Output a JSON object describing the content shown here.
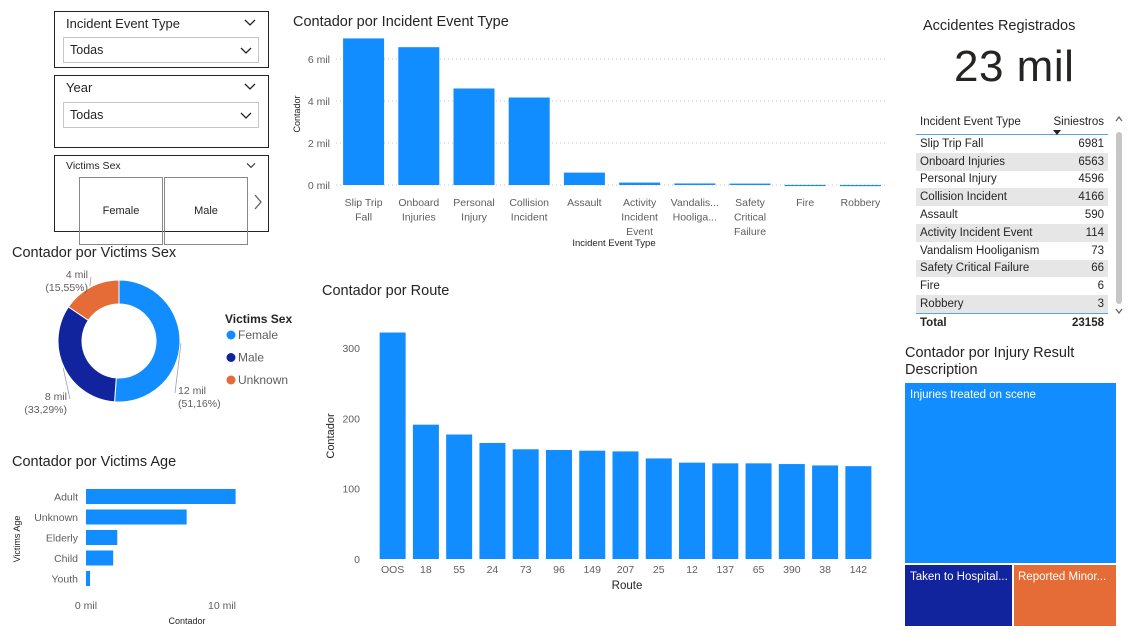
{
  "slicers": {
    "incident_type": {
      "title": "Incident Event Type",
      "value": "Todas"
    },
    "year": {
      "title": "Year",
      "value": "Todas"
    },
    "victims_sex": {
      "title": "Victims Sex",
      "tiles": [
        "Female",
        "Male"
      ]
    }
  },
  "kpi": {
    "title": "Accidentes Registrados",
    "value": "23 mil"
  },
  "matrix": {
    "headers": [
      "Incident Event Type",
      "Siniestros"
    ],
    "rows": [
      {
        "label": "Slip Trip Fall",
        "value": "6981"
      },
      {
        "label": "Onboard Injuries",
        "value": "6563"
      },
      {
        "label": "Personal Injury",
        "value": "4596"
      },
      {
        "label": "Collision Incident",
        "value": "4166"
      },
      {
        "label": "Assault",
        "value": "590"
      },
      {
        "label": "Activity Incident Event",
        "value": "114"
      },
      {
        "label": "Vandalism Hooliganism",
        "value": "73"
      },
      {
        "label": "Safety Critical Failure",
        "value": "66"
      },
      {
        "label": "Fire",
        "value": "6"
      },
      {
        "label": "Robbery",
        "value": "3"
      }
    ],
    "total_label": "Total",
    "total_value": "23158"
  },
  "colors": {
    "primary": "#118DFF",
    "navy": "#12239E",
    "orange": "#E66C37"
  },
  "chart_data": [
    {
      "type": "bar",
      "title": "Contador por Incident Event Type",
      "xlabel": "Incident Event Type",
      "ylabel": "Contador",
      "categories": [
        [
          "Slip Trip",
          "Fall"
        ],
        [
          "Onboard",
          "Injuries"
        ],
        [
          "Personal",
          "Injury"
        ],
        [
          "Collision",
          "Incident"
        ],
        [
          "Assault"
        ],
        [
          "Activity",
          "Incident",
          "Event"
        ],
        [
          "Vandalis...",
          "Hooliga..."
        ],
        [
          "Safety",
          "Critical",
          "Failure"
        ],
        [
          "Fire"
        ],
        [
          "Robbery"
        ]
      ],
      "values": [
        6981,
        6563,
        4596,
        4166,
        590,
        114,
        73,
        66,
        6,
        3
      ],
      "ylim": [
        0,
        7000
      ],
      "yticks": [
        0,
        2000,
        4000,
        6000
      ],
      "ytick_labels": [
        "0 mil",
        "2 mil",
        "4 mil",
        "6 mil"
      ],
      "grid": true
    },
    {
      "type": "pie",
      "title": "Contador por Victims Sex",
      "legend_title": "Victims Sex",
      "categories": [
        "Female",
        "Male",
        "Unknown"
      ],
      "values": [
        11848,
        7710,
        3600
      ],
      "labels": [
        [
          "12 mil",
          "(51,16%)"
        ],
        [
          "8 mil",
          "(33,29%)"
        ],
        [
          "4 mil",
          "(15,55%)"
        ]
      ],
      "legend_position": "right"
    },
    {
      "type": "bar",
      "orientation": "horizontal",
      "title": "Contador por Victims Age",
      "xlabel": "Contador",
      "ylabel": "Victims Age",
      "categories": [
        "Adult",
        "Unknown",
        "Elderly",
        "Child",
        "Youth"
      ],
      "values": [
        11000,
        7400,
        2300,
        2000,
        300
      ],
      "xlim": [
        0,
        12000
      ],
      "xticks": [
        0,
        10000
      ],
      "xtick_labels": [
        "0 mil",
        "10 mil"
      ]
    },
    {
      "type": "bar",
      "title": "Contador por Route",
      "xlabel": "Route",
      "ylabel": "Contador",
      "categories": [
        "OOS",
        "18",
        "55",
        "24",
        "73",
        "96",
        "149",
        "207",
        "25",
        "12",
        "137",
        "65",
        "390",
        "38",
        "142"
      ],
      "values": [
        322,
        191,
        177,
        165,
        156,
        155,
        154,
        153,
        143,
        137,
        136,
        136,
        135,
        133,
        132
      ],
      "ylim": [
        0,
        340
      ],
      "yticks": [
        0,
        100,
        200,
        300
      ],
      "grid": false
    },
    {
      "type": "treemap",
      "title": "Contador por Injury Result Description",
      "categories": [
        "Injuries treated on scene",
        "Taken to Hospital...",
        "Reported Minor..."
      ],
      "values": [
        18400,
        2400,
        2350
      ]
    }
  ]
}
